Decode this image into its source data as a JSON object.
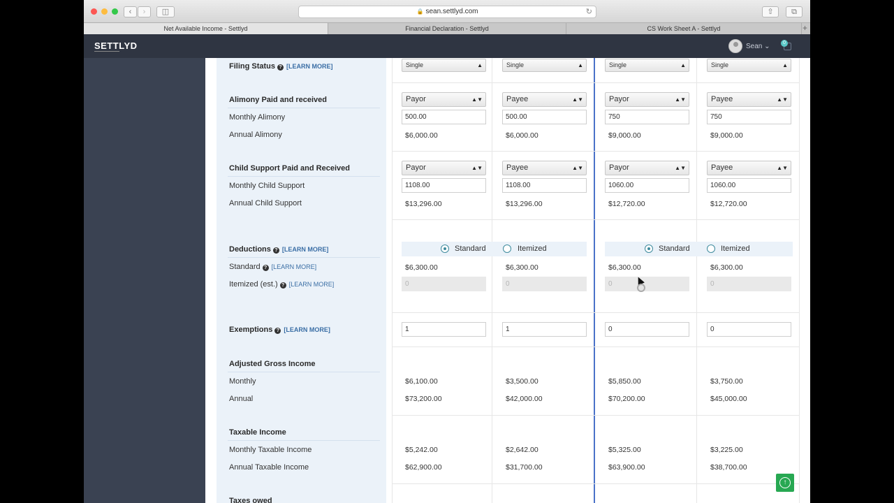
{
  "browser": {
    "url": "sean.settlyd.com",
    "tabs": [
      "Net Available Income - Settlyd",
      "Financial Declaration - Settlyd",
      "CS Work Sheet A - Settlyd"
    ],
    "active_tab": 0
  },
  "app": {
    "logo": "SETTLYD",
    "user_name": "Sean",
    "notification_count": "0",
    "brand_color": "#2f3542",
    "accent_color": "#27a852"
  },
  "labels": {
    "filing_status": "Filing Status",
    "learn_more": "[LEARN MORE]",
    "alimony_section": "Alimony Paid and received",
    "monthly_alimony": "Monthly Alimony",
    "annual_alimony": "Annual Alimony",
    "child_support_section": "Child Support Paid and Received",
    "monthly_child_support": "Monthly Child Support",
    "annual_child_support": "Annual Child Support",
    "deductions": "Deductions",
    "standard": "Standard",
    "itemized_est": "Itemized (est.)",
    "exemptions": "Exemptions",
    "agi_section": "Adjusted Gross Income",
    "monthly": "Monthly",
    "annual": "Annual",
    "taxable_section": "Taxable Income",
    "monthly_taxable": "Monthly Taxable Income",
    "annual_taxable": "Annual Taxable Income",
    "taxes_owed": "Taxes owed"
  },
  "radio": {
    "standard": "Standard",
    "itemized": "Itemized"
  },
  "columns": [
    {
      "filing_status": "Single",
      "alimony_role": "Payor",
      "monthly_alimony": "500.00",
      "annual_alimony": "$6,000.00",
      "cs_role": "Payor",
      "monthly_cs": "1108.00",
      "annual_cs": "$13,296.00",
      "standard_deduction": "$6,300.00",
      "itemized_placeholder": "0",
      "exemptions": "1",
      "agi_monthly": "$6,100.00",
      "agi_annual": "$73,200.00",
      "taxable_monthly": "$5,242.00",
      "taxable_annual": "$62,900.00"
    },
    {
      "filing_status": "Single",
      "alimony_role": "Payee",
      "monthly_alimony": "500.00",
      "annual_alimony": "$6,000.00",
      "cs_role": "Payee",
      "monthly_cs": "1108.00",
      "annual_cs": "$13,296.00",
      "standard_deduction": "$6,300.00",
      "itemized_placeholder": "0",
      "exemptions": "1",
      "agi_monthly": "$3,500.00",
      "agi_annual": "$42,000.00",
      "taxable_monthly": "$2,642.00",
      "taxable_annual": "$31,700.00"
    },
    {
      "filing_status": "Single",
      "alimony_role": "Payor",
      "monthly_alimony": "750",
      "annual_alimony": "$9,000.00",
      "cs_role": "Payor",
      "monthly_cs": "1060.00",
      "annual_cs": "$12,720.00",
      "standard_deduction": "$6,300.00",
      "itemized_placeholder": "0",
      "exemptions": "0",
      "agi_monthly": "$5,850.00",
      "agi_annual": "$70,200.00",
      "taxable_monthly": "$5,325.00",
      "taxable_annual": "$63,900.00"
    },
    {
      "filing_status": "Single",
      "alimony_role": "Payee",
      "monthly_alimony": "750",
      "annual_alimony": "$9,000.00",
      "cs_role": "Payee",
      "monthly_cs": "1060.00",
      "annual_cs": "$12,720.00",
      "standard_deduction": "$6,300.00",
      "itemized_placeholder": "0",
      "exemptions": "0",
      "agi_monthly": "$3,750.00",
      "agi_annual": "$45,000.00",
      "taxable_monthly": "$3,225.00",
      "taxable_annual": "$38,700.00"
    }
  ]
}
